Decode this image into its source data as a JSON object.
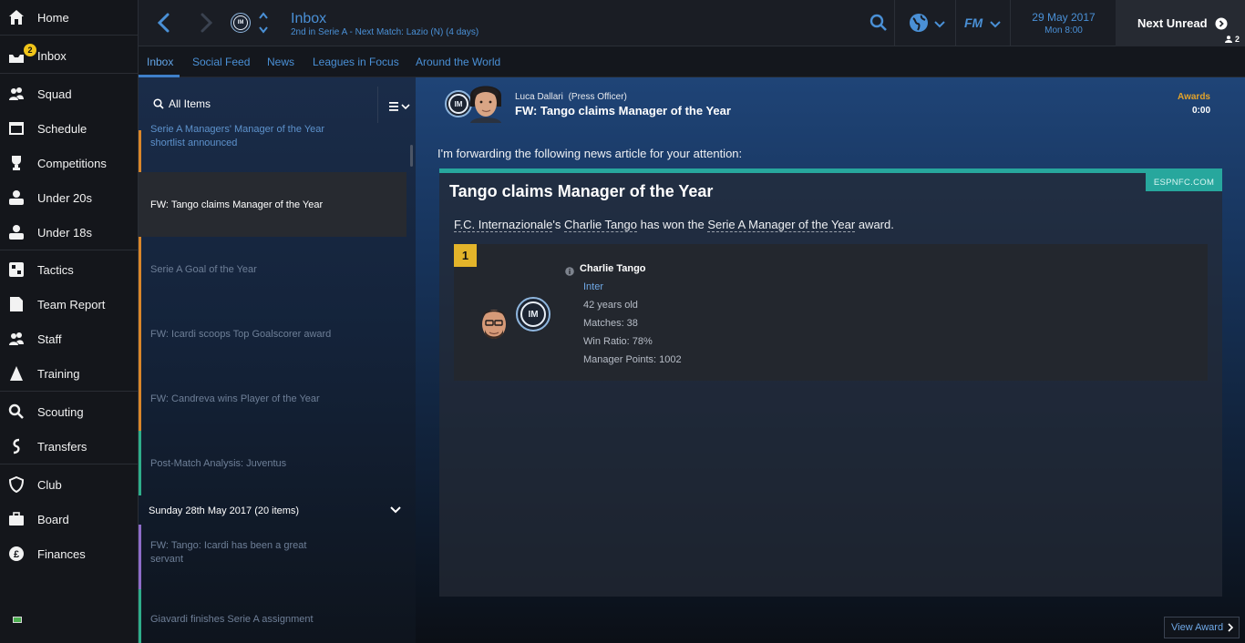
{
  "sidebar": {
    "inbox_badge": "2",
    "items": [
      {
        "label": "Home",
        "icon": "home-icon"
      },
      {
        "label": "Inbox",
        "icon": "inbox-icon"
      },
      {
        "label": "Squad",
        "icon": "squad-icon"
      },
      {
        "label": "Schedule",
        "icon": "calendar-icon"
      },
      {
        "label": "Competitions",
        "icon": "trophy-icon"
      },
      {
        "label": "Under 20s",
        "icon": "u20-icon"
      },
      {
        "label": "Under 18s",
        "icon": "u18-icon"
      },
      {
        "label": "Tactics",
        "icon": "tactics-icon"
      },
      {
        "label": "Team Report",
        "icon": "report-icon"
      },
      {
        "label": "Staff",
        "icon": "staff-icon"
      },
      {
        "label": "Training",
        "icon": "training-icon"
      },
      {
        "label": "Scouting",
        "icon": "search-icon"
      },
      {
        "label": "Transfers",
        "icon": "transfers-icon"
      },
      {
        "label": "Club",
        "icon": "shield-icon"
      },
      {
        "label": "Board",
        "icon": "briefcase-icon"
      },
      {
        "label": "Finances",
        "icon": "pound-icon"
      }
    ]
  },
  "header": {
    "title": "Inbox",
    "subtitle": "2nd in Serie A - Next Match: Lazio (N) (4 days)",
    "date": "29 May 2017",
    "time": "Mon 8:00",
    "next_unread": "Next Unread",
    "unread_count": "2",
    "fm_logo": "FM"
  },
  "tabs": [
    "Inbox",
    "Social Feed",
    "News",
    "Leagues in Focus",
    "Around the World"
  ],
  "list": {
    "filter": "All Items",
    "items": [
      {
        "title_line1": "Serie A Managers' Manager of the Year",
        "title_line2": "shortlist announced",
        "bar_color": "#d9862a"
      },
      {
        "title_line1": "FW: Tango claims Manager of the Year",
        "bar_color": "#d9862a"
      },
      {
        "title_line1": "Serie A Goal of the Year",
        "bar_color": "#d9862a"
      },
      {
        "title_line1": "FW: Icardi scoops Top Goalscorer award",
        "bar_color": "#d9862a"
      },
      {
        "title_line1": "FW: Candreva wins Player of the Year",
        "bar_color": "#d9862a"
      },
      {
        "title_line1": "Post-Match Analysis: Juventus",
        "bar_color": "#2eae8a"
      },
      {
        "title_line1": "FW: Tango: Icardi has been a great",
        "title_line2": "servant",
        "bar_color": "#8e6cc8"
      },
      {
        "title_line1": "Giavardi finishes Serie A assignment",
        "bar_color": "#2eae8a"
      }
    ],
    "day_header": "Sunday 28th May 2017 (20 items)"
  },
  "message": {
    "sender": "Luca Dallari",
    "role": "(Press Officer)",
    "subject": "FW: Tango claims Manager of the Year",
    "category": "Awards",
    "time": "0:00",
    "intro": "I'm forwarding the following news article for your attention:",
    "source": "ESPNFC.COM",
    "headline": "Tango claims Manager of the Year",
    "body_prefix": "F.C. Internazionale",
    "body_mid1": "'s ",
    "body_manager": "Charlie Tango",
    "body_mid2": " has won the ",
    "body_award": "Serie A Manager of the Year",
    "body_suffix": " award.",
    "rank": "1",
    "winner": {
      "name": "Charlie Tango",
      "club": "Inter",
      "age": "42 years old",
      "matches": "Matches: 38",
      "win_ratio": "Win Ratio: 78%",
      "points": "Manager Points: 1002"
    },
    "view_award": "View Award"
  },
  "colors": {
    "accent_blue": "#4a90d6",
    "teal": "#27a79d",
    "awards_orange": "#e3a32a",
    "badge_yellow": "#f0c419"
  }
}
